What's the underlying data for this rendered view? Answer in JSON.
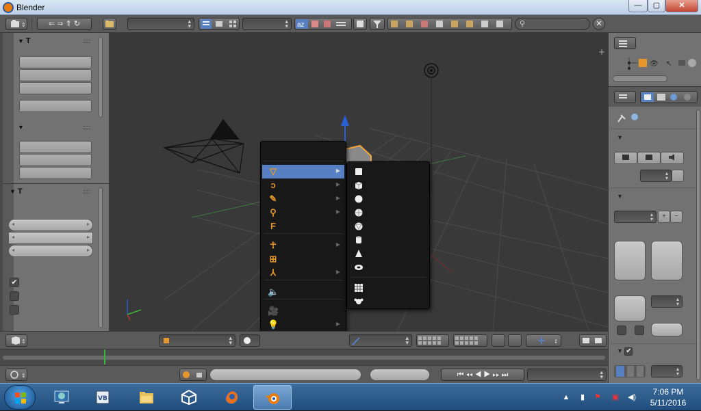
{
  "window": {
    "title": "Blender",
    "minimize_glyph": "—",
    "maximize_glyph": "▢",
    "close_glyph": "✕"
  },
  "top_header": {
    "editor_type_icon": "info-icon",
    "scene_field_value": "",
    "render_engine_value": "",
    "search_placeholder": "",
    "close_glyph": "✕"
  },
  "tool_shelf": {
    "panel1_header": "T",
    "panel2_header": "",
    "panel3_header": "T",
    "checkbox_checked": "✔",
    "checkbox_items": [
      true,
      false,
      false
    ]
  },
  "add_menu": {
    "items": [
      {
        "icon": "mesh-icon",
        "glyph": "▽",
        "submenu": true,
        "active": true
      },
      {
        "icon": "curve-icon",
        "glyph": "ↄ",
        "submenu": true
      },
      {
        "icon": "surface-icon",
        "glyph": "✎",
        "submenu": true
      },
      {
        "icon": "metaball-icon",
        "glyph": "⚲",
        "submenu": true
      },
      {
        "icon": "text-icon",
        "glyph": "F",
        "submenu": false
      },
      {
        "icon": "armature-icon",
        "glyph": "☥",
        "submenu": true
      },
      {
        "icon": "lattice-icon",
        "glyph": "⊞",
        "submenu": false
      },
      {
        "icon": "empty-icon",
        "glyph": "⅄",
        "submenu": true
      },
      {
        "icon": "speaker-icon",
        "glyph": "🔈",
        "submenu": false
      },
      {
        "icon": "camera-icon",
        "glyph": "🎥",
        "submenu": false
      },
      {
        "icon": "lamp-icon",
        "glyph": "💡",
        "submenu": true
      },
      {
        "icon": "force-field-icon",
        "glyph": "⅄",
        "submenu": true
      },
      {
        "icon": "group-instance-icon",
        "glyph": "⅄",
        "submenu": true
      }
    ]
  },
  "mesh_submenu": {
    "items": [
      {
        "icon": "plane-icon"
      },
      {
        "icon": "cube-icon"
      },
      {
        "icon": "circle-icon"
      },
      {
        "icon": "uv-sphere-icon"
      },
      {
        "icon": "ico-sphere-icon"
      },
      {
        "icon": "cylinder-icon"
      },
      {
        "icon": "cone-icon"
      },
      {
        "icon": "torus-icon"
      },
      {
        "icon": "grid-icon"
      },
      {
        "icon": "monkey-icon"
      }
    ]
  },
  "taskbar": {
    "time": "7:06 PM",
    "date": "5/11/2016",
    "apps": [
      {
        "icon": "desktop-icon"
      },
      {
        "icon": "visual-basic-icon"
      },
      {
        "icon": "file-explorer-icon"
      },
      {
        "icon": "unity-icon"
      },
      {
        "icon": "firefox-icon"
      },
      {
        "icon": "blender-icon",
        "active": true
      }
    ]
  },
  "colors": {
    "menu_highlight": "#5680c2",
    "accent_orange": "#e6962a",
    "viewport_bg": "#393939",
    "panel_bg": "#727272"
  }
}
